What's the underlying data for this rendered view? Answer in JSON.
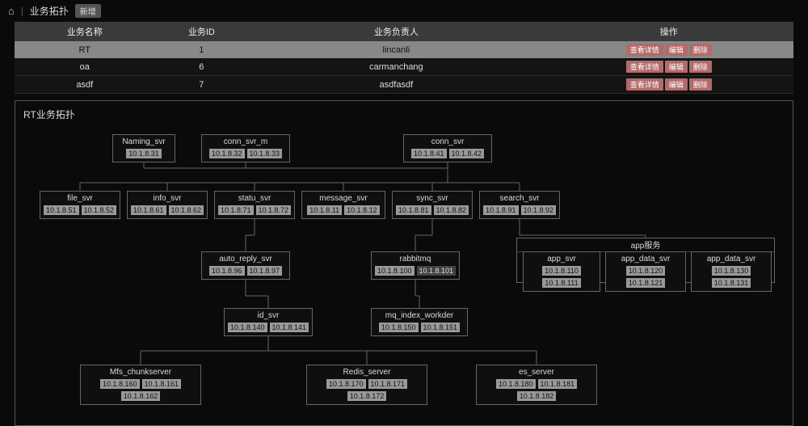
{
  "header": {
    "breadcrumb": "业务拓扑",
    "new_btn": "新增"
  },
  "table": {
    "headers": {
      "name": "业务名称",
      "id": "业务ID",
      "owner": "业务负责人",
      "op": "操作"
    },
    "actions": {
      "detail": "查看详情",
      "edit": "编辑",
      "del": "删除"
    },
    "rows": [
      {
        "name": "RT",
        "id": "1",
        "owner": "lincanli",
        "selected": true
      },
      {
        "name": "oa",
        "id": "6",
        "owner": "carmanchang",
        "selected": false
      },
      {
        "name": "asdf",
        "id": "7",
        "owner": "asdfasdf",
        "selected": false
      }
    ]
  },
  "topology": {
    "title": "RT业务拓扑",
    "app_group": "app服务",
    "nodes": {
      "naming_svr": {
        "label": "Naming_svr",
        "ips": [
          "10.1.8.31"
        ]
      },
      "conn_svr_m": {
        "label": "conn_svr_m",
        "ips": [
          "10.1.8.32",
          "10.1.8.33"
        ]
      },
      "conn_svr": {
        "label": "conn_svr",
        "ips": [
          "10.1.8.41",
          "10.1.8.42"
        ]
      },
      "file_svr": {
        "label": "file_svr",
        "ips": [
          "10.1.8.51",
          "10.1.8.52"
        ]
      },
      "info_svr": {
        "label": "info_svr",
        "ips": [
          "10.1.8.61",
          "10.1.8.62"
        ]
      },
      "statu_svr": {
        "label": "statu_svr",
        "ips": [
          "10.1.8.71",
          "10.1.8.72"
        ]
      },
      "message_svr": {
        "label": "message_svr",
        "ips": [
          "10.1.8.11",
          "10.1.8.12"
        ]
      },
      "sync_svr": {
        "label": "sync_svr",
        "ips": [
          "10.1.8.81",
          "10.1.8.82"
        ]
      },
      "search_svr": {
        "label": "search_svr",
        "ips": [
          "10.1.8.91",
          "10.1.8.92"
        ]
      },
      "auto_reply_svr": {
        "label": "auto_reply_svr",
        "ips": [
          "10.1.8.96",
          "10.1.8.97"
        ]
      },
      "rabbitmq": {
        "label": "rabbitmq",
        "ips": [
          "10.1.8.100",
          "10.1.8.101"
        ],
        "dark_last": true
      },
      "app_svr": {
        "label": "app_svr",
        "ips": [
          "10.1.8.110",
          "10.1.8.111"
        ]
      },
      "app_data_svr1": {
        "label": "app_data_svr",
        "ips": [
          "10.1.8.120",
          "10.1.8.121"
        ]
      },
      "app_data_svr2": {
        "label": "app_data_svr",
        "ips": [
          "10.1.8.130",
          "10.1.8.131"
        ]
      },
      "id_svr": {
        "label": "id_svr",
        "ips": [
          "10.1.8.140",
          "10.1.8.141"
        ]
      },
      "mq_index_workder": {
        "label": "mq_index_workder",
        "ips": [
          "10.1.8.150",
          "10.1.8.151"
        ]
      },
      "mfs_chunkserver": {
        "label": "Mfs_chunkserver",
        "ips": [
          "10.1.8.160",
          "10.1.8.161",
          "10.1.8.162"
        ]
      },
      "redis_server": {
        "label": "Redis_server",
        "ips": [
          "10.1.8.170",
          "10.1.8.171",
          "10.1.8.172"
        ]
      },
      "es_server": {
        "label": "es_server",
        "ips": [
          "10.1.8.180",
          "10.1.8.181",
          "10.1.8.182"
        ]
      }
    }
  }
}
